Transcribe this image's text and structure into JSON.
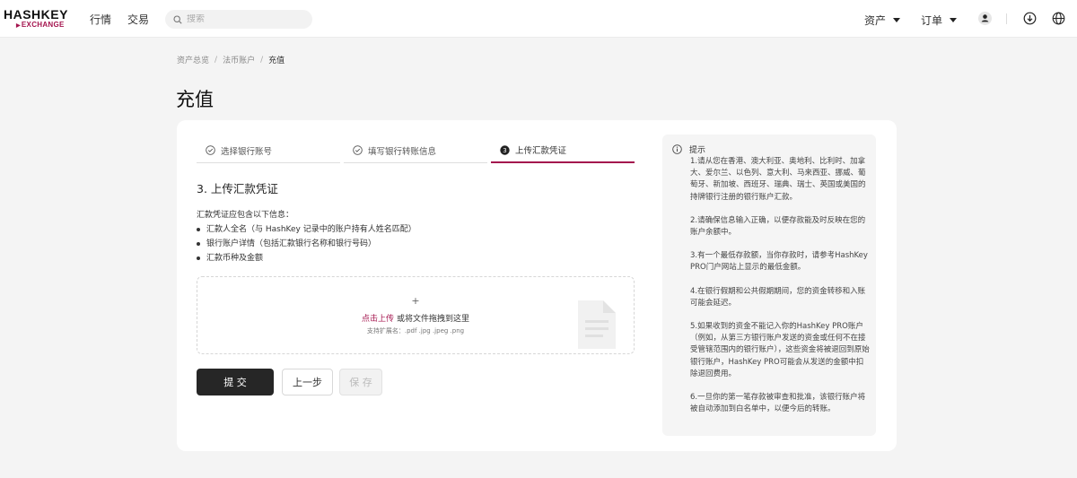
{
  "header": {
    "logo_top": "HASHKEY",
    "logo_bottom": "EXCHANGE",
    "nav": [
      "行情",
      "交易"
    ],
    "search_placeholder": "搜索",
    "menu_assets": "资产",
    "menu_orders": "订单",
    "icons": [
      "user-icon",
      "download-icon",
      "globe-icon"
    ]
  },
  "breadcrumb": {
    "items": [
      "资产总览",
      "法币账户",
      "充值"
    ],
    "separator": "/"
  },
  "page": {
    "title": "充值"
  },
  "steps": [
    {
      "label": "选择银行账号",
      "state": "done"
    },
    {
      "label": "填写银行转账信息",
      "state": "done"
    },
    {
      "label": "上传汇款凭证",
      "state": "active",
      "number": "3"
    }
  ],
  "form": {
    "section_title": "3. 上传汇款凭证",
    "requirements_title": "汇款凭证应包含以下信息：",
    "requirements": [
      "汇款人全名（与 HashKey 记录中的账户持有人姓名匹配）",
      "银行账户详情（包括汇款银行名称和银行号码）",
      "汇款币种及金额"
    ],
    "upload": {
      "plus": "+",
      "link_text": "点击上传",
      "hint_text": "或将文件拖拽到这里",
      "extensions": "支持扩展名：.pdf .jpg .jpeg .png"
    },
    "buttons": {
      "submit": "提 交",
      "prev": "上一步",
      "save": "保 存"
    }
  },
  "tips": {
    "title": "提示",
    "items": [
      "1.请从您在香港、澳大利亚、奥地利、比利时、加拿大、爱尔兰、以色列、意大利、马来西亚、挪威、葡萄牙、新加坡、西班牙、瑞典、瑞士、英国或美国的持牌银行注册的银行账户汇款。",
      "2.请确保信息输入正确，以便存款能及时反映在您的账户余额中。",
      "3.有一个最低存款额，当你存款时，请参考HashKey PRO门户网站上显示的最低金额。",
      "4.在银行假期和公共假期期间，您的资金转移和入账可能会延迟。",
      "5.如果收到的资金不能记入你的HashKey PRO账户（例如，从第三方银行账户发送的资金或任何不在接受管辖范围内的银行账户），这些资金将被退回到原始银行账户，HashKey PRO可能会从发送的金额中扣除退回费用。",
      "6.一旦你的第一笔存款被审查和批准，该银行账户将被自动添加到白名单中，以便今后的转账。"
    ]
  },
  "colors": {
    "accent": "#a4144e",
    "primary_button": "#262626",
    "background": "#f4f4f4"
  }
}
